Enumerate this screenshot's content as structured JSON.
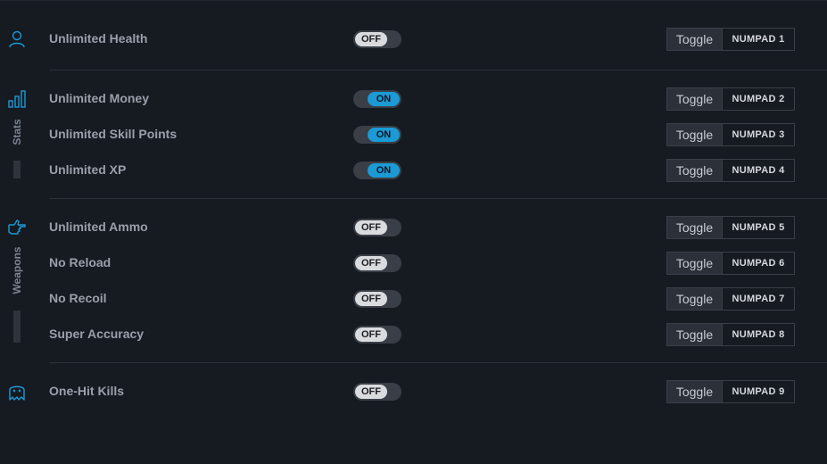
{
  "colors": {
    "accent": "#1b9ad6",
    "background": "#161a21",
    "icon": "#1b9ad6"
  },
  "sections": [
    {
      "name": "",
      "icon": "user-icon",
      "rows": [
        {
          "label": "Unlimited Health",
          "state": "OFF",
          "action": "Toggle",
          "key": "NUMPAD 1"
        }
      ]
    },
    {
      "name": "Stats",
      "icon": "stats-bars-icon",
      "rows": [
        {
          "label": "Unlimited Money",
          "state": "ON",
          "action": "Toggle",
          "key": "NUMPAD 2"
        },
        {
          "label": "Unlimited Skill Points",
          "state": "ON",
          "action": "Toggle",
          "key": "NUMPAD 3"
        },
        {
          "label": "Unlimited XP",
          "state": "ON",
          "action": "Toggle",
          "key": "NUMPAD 4"
        }
      ]
    },
    {
      "name": "Weapons",
      "icon": "hand-pointing-icon",
      "rows": [
        {
          "label": "Unlimited Ammo",
          "state": "OFF",
          "action": "Toggle",
          "key": "NUMPAD 5"
        },
        {
          "label": "No Reload",
          "state": "OFF",
          "action": "Toggle",
          "key": "NUMPAD 6"
        },
        {
          "label": "No Recoil",
          "state": "OFF",
          "action": "Toggle",
          "key": "NUMPAD 7"
        },
        {
          "label": "Super Accuracy",
          "state": "OFF",
          "action": "Toggle",
          "key": "NUMPAD 8"
        }
      ]
    },
    {
      "name": "",
      "icon": "ghost-icon",
      "rows": [
        {
          "label": "One-Hit Kills",
          "state": "OFF",
          "action": "Toggle",
          "key": "NUMPAD 9"
        }
      ]
    }
  ]
}
